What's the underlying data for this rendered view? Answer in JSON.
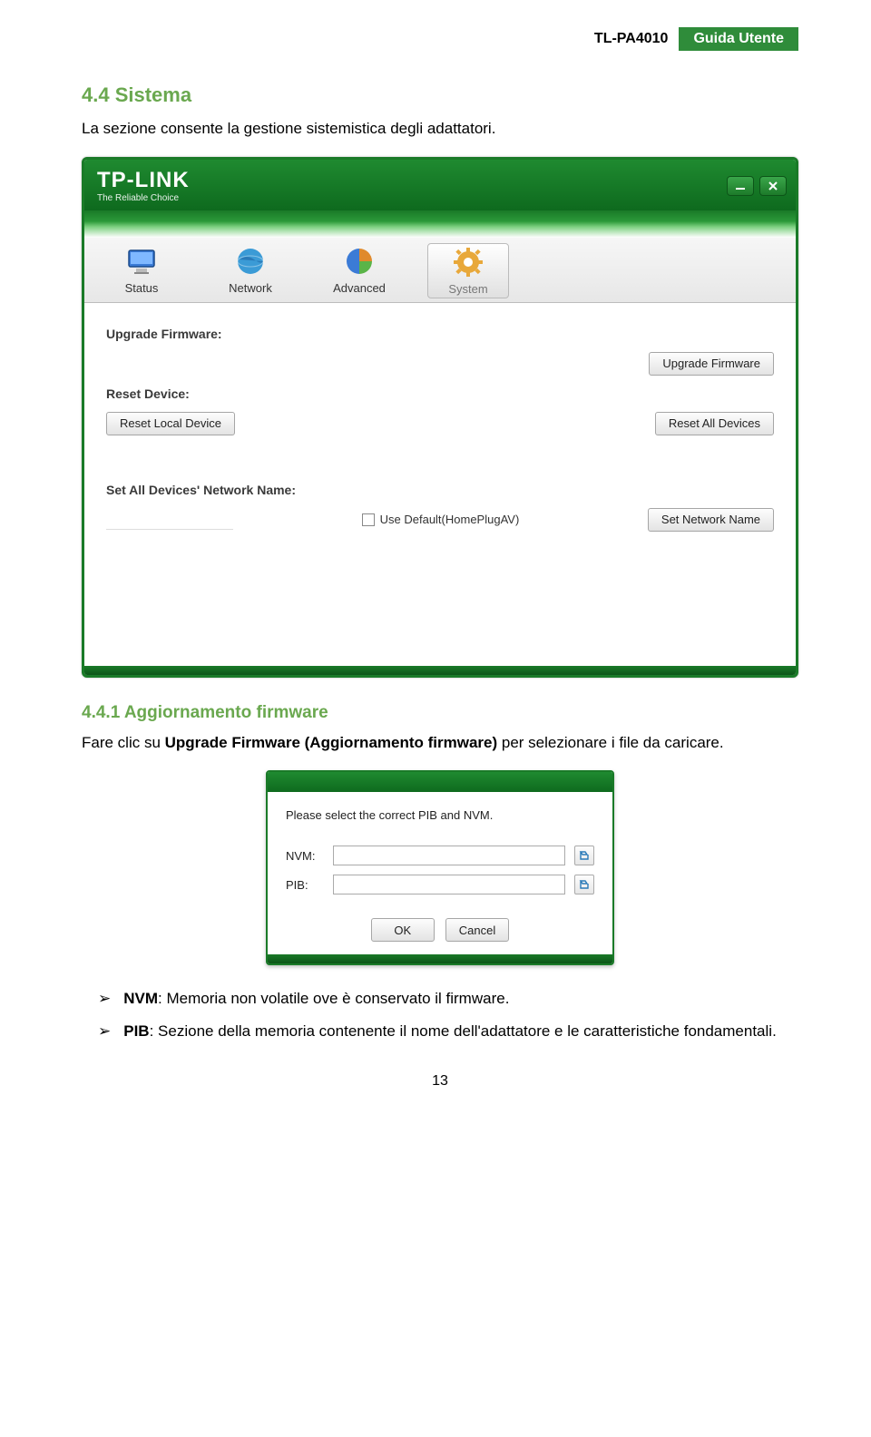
{
  "header": {
    "model": "TL-PA4010",
    "badge": "Guida Utente"
  },
  "section": {
    "num_title": "4.4 Sistema",
    "desc": "La sezione consente la gestione sistemistica degli adattatori."
  },
  "app": {
    "logo_main": "TP-LINK",
    "logo_sub": "The Reliable Choice",
    "tabs": {
      "status": "Status",
      "network": "Network",
      "advanced": "Advanced",
      "system": "System"
    },
    "labels": {
      "upgrade_firmware": "Upgrade Firmware:",
      "reset_device": "Reset Device:",
      "set_net_name": "Set All Devices' Network Name:"
    },
    "buttons": {
      "upgrade": "Upgrade Firmware",
      "reset_local": "Reset Local Device",
      "reset_all": "Reset All Devices",
      "set_net": "Set Network Name"
    },
    "checkbox": "Use Default(HomePlugAV)"
  },
  "subsection": {
    "title": "4.4.1 Aggiornamento firmware",
    "desc_pre": "Fare clic su ",
    "desc_bold": "Upgrade Firmware (Aggiornamento firmware)",
    "desc_post": " per selezionare i file da caricare."
  },
  "dialog": {
    "prompt": "Please select the correct PIB and NVM.",
    "nvm_label": "NVM:",
    "pib_label": "PIB:",
    "ok": "OK",
    "cancel": "Cancel"
  },
  "bullets": {
    "nvm_pre": "NVM",
    "nvm_post": ": Memoria non volatile ove è conservato il firmware.",
    "pib_pre": "PIB",
    "pib_post": ": Sezione della memoria contenente il nome dell'adattatore e le caratteristiche fondamentali."
  },
  "page_number": "13",
  "glyphs": {
    "arrow": "➤",
    "bullet": "➢"
  }
}
